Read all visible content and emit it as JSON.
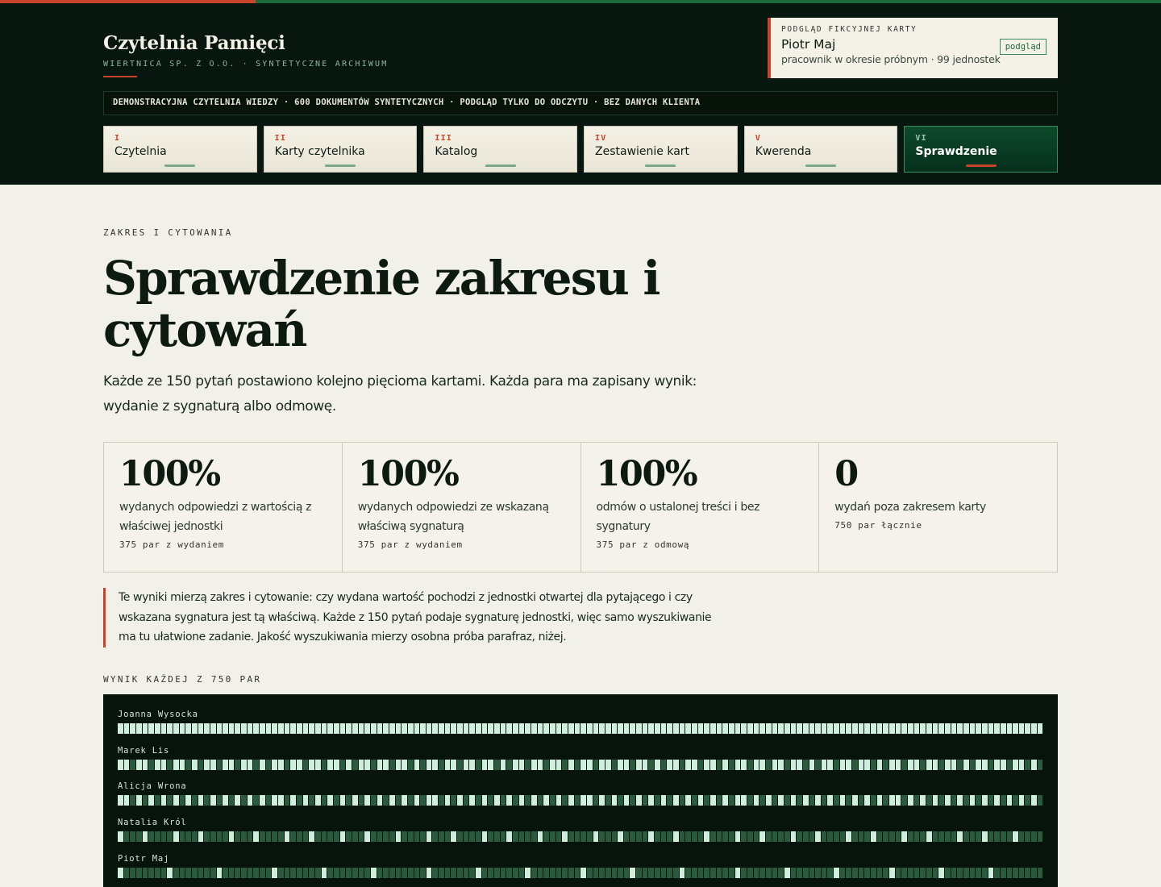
{
  "brand": {
    "title": "Czytelnia Pamięci",
    "subtitle": "WIERTNICA SP. Z O.O. · SYNTETYCZNE ARCHIWUM"
  },
  "card_preview": {
    "label": "PODGLĄD FIKCYJNEJ KARTY",
    "name": "Piotr Maj",
    "meta": "pracownik w okresie próbnym · 99 jednostek",
    "button": "podgląd"
  },
  "demo_banner": "DEMONSTRACYJNA CZYTELNIA WIEDZY · 600 DOKUMENTÓW SYNTETYCZNYCH · PODGLĄD TYLKO DO ODCZYTU · BEZ DANYCH KLIENTA",
  "tabs": [
    {
      "num": "I",
      "label": "Czytelnia",
      "active": false
    },
    {
      "num": "II",
      "label": "Karty czytelnika",
      "active": false
    },
    {
      "num": "III",
      "label": "Katalog",
      "active": false
    },
    {
      "num": "IV",
      "label": "Zestawienie kart",
      "active": false
    },
    {
      "num": "V",
      "label": "Kwerenda",
      "active": false
    },
    {
      "num": "VI",
      "label": "Sprawdzenie",
      "active": true
    }
  ],
  "page": {
    "eyebrow": "ZAKRES I CYTOWANIA",
    "title": "Sprawdzenie zakresu i cytowań",
    "lede": "Każde ze 150 pytań postawiono kolejno pięcioma kartami. Każda para ma zapisany wynik: wydanie z sygnaturą albo odmowę."
  },
  "stats": [
    {
      "value": "100%",
      "desc": "wydanych odpowiedzi z wartością z właściwej jednostki",
      "count": "375 par z wydaniem"
    },
    {
      "value": "100%",
      "desc": "wydanych odpowiedzi ze wskazaną właściwą sygnaturą",
      "count": "375 par z wydaniem"
    },
    {
      "value": "100%",
      "desc": "odmów o ustalonej treści i bez sygnatury",
      "count": "375 par z odmową"
    },
    {
      "value": "0",
      "desc": "wydań poza zakresem karty",
      "count": "750 par łącznie"
    }
  ],
  "note": "Te wyniki mierzą zakres i cytowanie: czy wydana wartość pochodzi z jednostki otwartej dla pytającego i czy wskazana sygnatura jest tą właściwą. Każde z 150 pytań podaje sygnaturę jednostki, więc samo wyszukiwanie ma tu ułatwione zadanie. Jakość wyszukiwania mierzy osobna próba parafraz, niżej.",
  "results_section": {
    "label": "WYNIK KAŻDEJ Z 750 PAR",
    "cells_per_row": 150,
    "rows": [
      {
        "name": "Joanna Wysocka",
        "released": 150
      },
      {
        "name": "Marek Lis",
        "released": 96
      },
      {
        "name": "Alicja Wrona",
        "released": 78
      },
      {
        "name": "Natalia Król",
        "released": 33
      },
      {
        "name": "Piotr Maj",
        "released": 18
      }
    ]
  },
  "colors": {
    "accent_red": "#c8442b",
    "brand_green": "#1b6b3e",
    "dark_bg": "#07170f",
    "cell_released": "#cfeedd",
    "cell_refused": "#2a5a3e"
  }
}
